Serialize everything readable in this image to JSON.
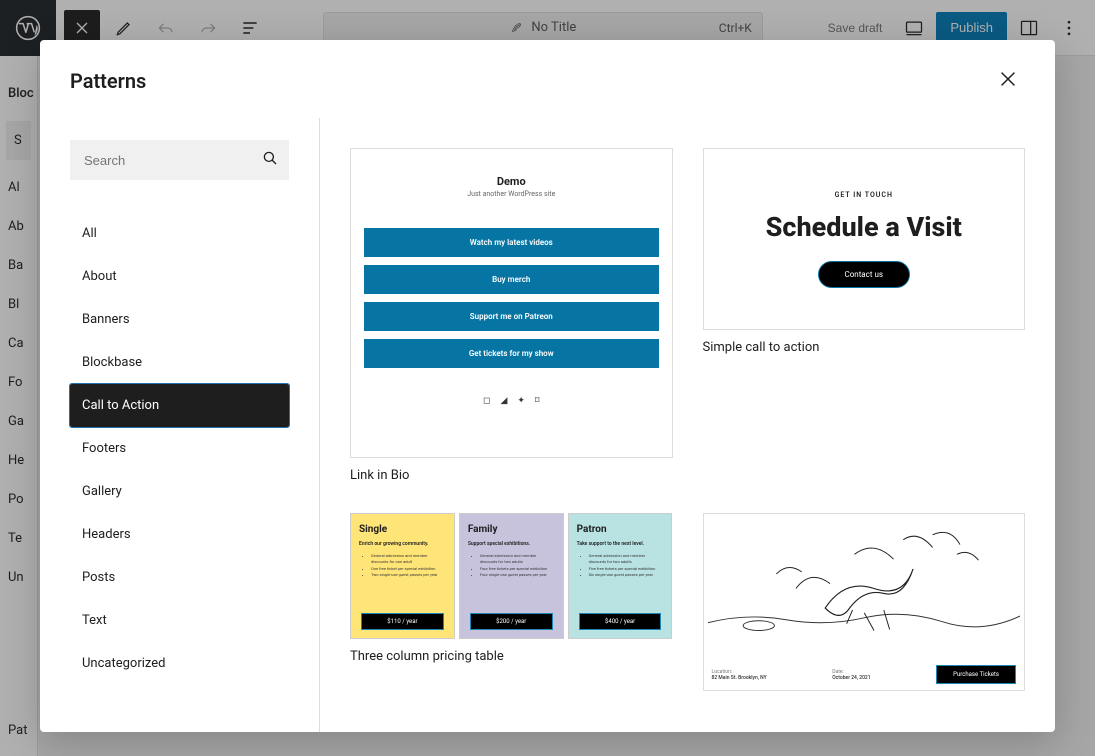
{
  "topbar": {
    "title": "No Title",
    "shortcut": "Ctrl+K",
    "save_draft": "Save draft",
    "publish": "Publish"
  },
  "bg_panel": {
    "tab_label": "Bloc",
    "search_placeholder": "S",
    "items": [
      "Al",
      "Ab",
      "Ba",
      "Bl",
      "Ca",
      "Fo",
      "Ga",
      "He",
      "Po",
      "Te",
      "Un"
    ],
    "footer": "Pat"
  },
  "modal": {
    "title": "Patterns",
    "search_placeholder": "Search",
    "categories": [
      "All",
      "About",
      "Banners",
      "Blockbase",
      "Call to Action",
      "Footers",
      "Gallery",
      "Headers",
      "Posts",
      "Text",
      "Uncategorized"
    ],
    "active_category": "Call to Action"
  },
  "patterns": {
    "link_in_bio": {
      "label": "Link in Bio",
      "site_title": "Demo",
      "site_tagline": "Just another WordPress site",
      "buttons": [
        "Watch my latest videos",
        "Buy merch",
        "Support me on Patreon",
        "Get tickets for my show"
      ]
    },
    "simple_cta": {
      "label": "Simple call to action",
      "eyebrow": "GET IN TOUCH",
      "headline": "Schedule a Visit",
      "button": "Contact us"
    },
    "pricing": {
      "label": "Three column pricing table",
      "tiers": [
        {
          "name": "Single",
          "tag": "Enrich our growing community.",
          "price": "$110 / year",
          "bullets": [
            "General admission and member discounts for one adult",
            "One free ticket per special exhibition",
            "Two single-use guest passes per year"
          ]
        },
        {
          "name": "Family",
          "tag": "Support special exhibitions.",
          "price": "$200 / year",
          "bullets": [
            "General admission and member discounts for two adults",
            "Four free tickets per special exhibition",
            "Four single-use guest passes per year"
          ]
        },
        {
          "name": "Patron",
          "tag": "Take support to the next level.",
          "price": "$400 / year",
          "bullets": [
            "General admission and member discounts for two adults",
            "Five free tickets per special exhibition",
            "Six single-use guest passes per year"
          ]
        }
      ]
    },
    "event": {
      "location_label": "Location:",
      "location_value": "82 Main St. Brooklyn, NY",
      "date_label": "Date:",
      "date_value": "October 24, 2021",
      "button": "Purchase Tickets"
    }
  }
}
